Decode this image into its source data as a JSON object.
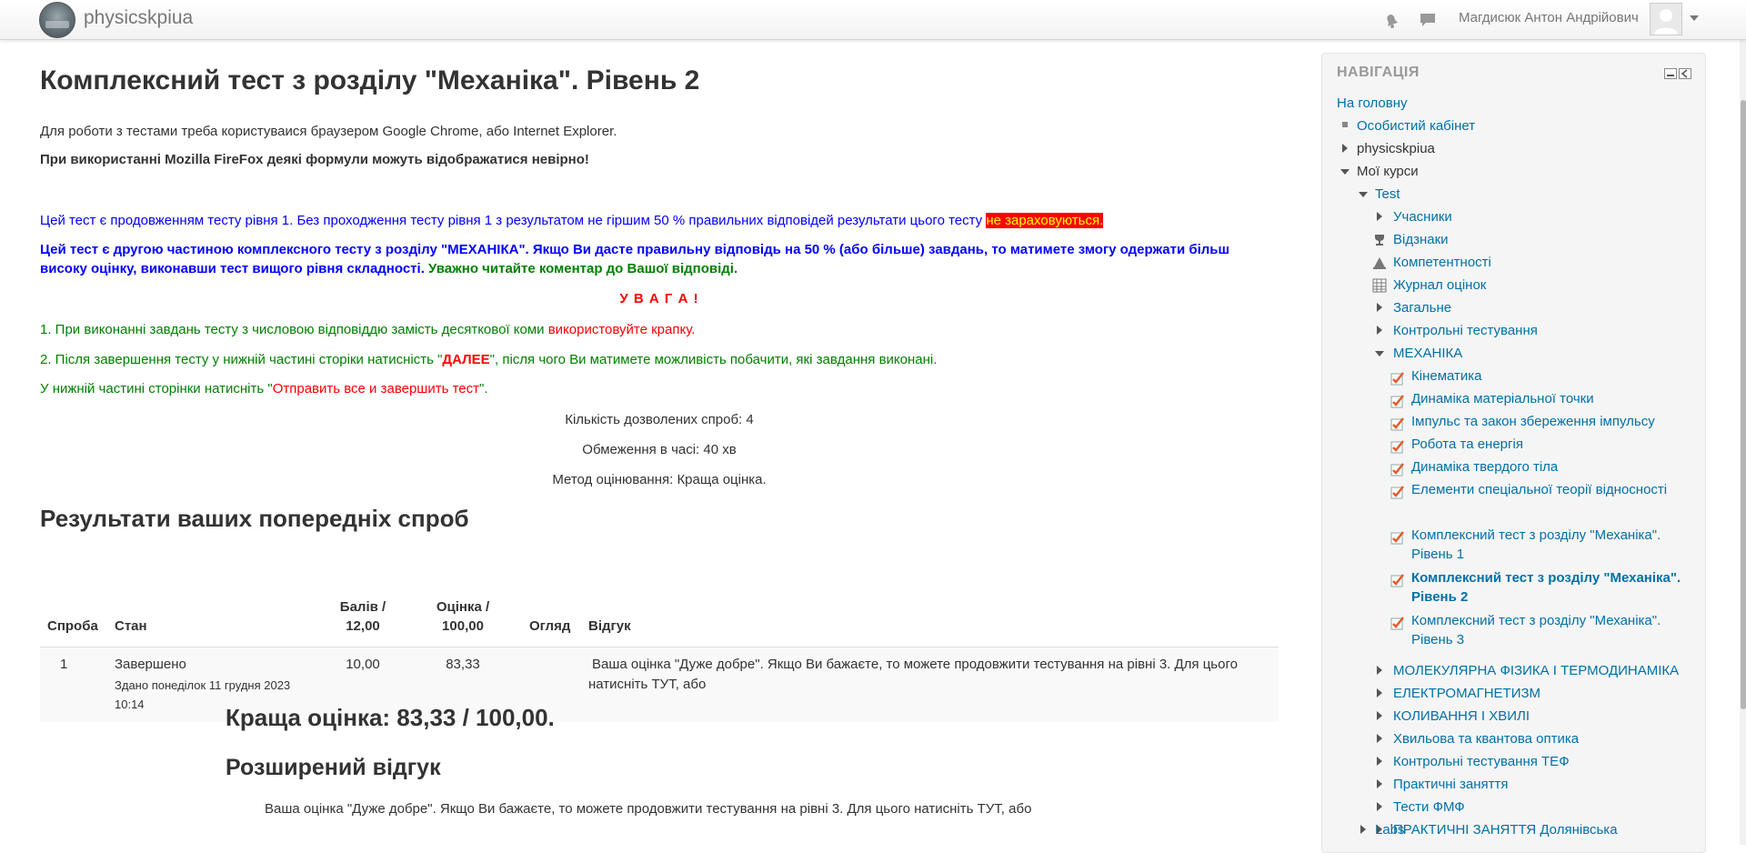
{
  "header": {
    "brand": "physicskpiua",
    "user_name": "Магдисюк Антон Андрійович"
  },
  "main": {
    "title": "Комплексний тест з розділу \"Механіка\". Рівень 2",
    "intro_line1": "Для роботи з тестами треба користуваися браузером Google Chrome, або Internet Explorer.",
    "intro_line2": "При використанні Mozilla FireFox деякі формули можуть відображатися невірно!",
    "info_blue": "Цей тест є продовженням тесту рівня 1. Без проходження тесту рівня 1 з результатом не гіршим 50 % правильних відповідей результати цього тесту ",
    "info_highlight": "не зараховуються.",
    "bold_blue_line1": "Цей тест є другою частиною комплексного тесту з розділу \"МЕХАНІКА\". Якщо Ви дасте правильну відповідь на 50 % (або більше) завдань, то матимете змогу одержати більш",
    "bold_blue_line2": "високу оцінку, виконавши тест вищого рівня складності.",
    "bold_green_tail": " Уважно читайте коментар до Вашої відповіді.",
    "attention": "У В А Г А !",
    "rule1_green": "1. При виконанні завдань тесту з числовою відповіддю замість десяткової коми ",
    "rule1_red": "використовуйте крапку.",
    "rule2_green_a": "2. Після завершення тесту у нижній частині сторіки натисність \"",
    "rule2_red": "ДАЛЕЕ",
    "rule2_green_b": "\", після чого Ви матимете можливість побачити, які завдання виконані.",
    "rule3_green_a": "У нижній частині сторінки натисніть \"",
    "rule3_red": "Отправить все и завершить тест",
    "rule3_green_b": "\".",
    "attempts_allowed": "Кількість дозволених спроб: 4",
    "time_limit": "Обмеження в часі: 40 хв",
    "grading_method": "Метод оцінювання: Краща оцінка.",
    "results_title": "Результати ваших попередніх спроб",
    "table": {
      "headers": {
        "attempt": "Спроба",
        "state": "Стан",
        "marks_a": "Балів /",
        "marks_b": "12,00",
        "grade_a": "Оцінка /",
        "grade_b": "100,00",
        "review": "Огляд",
        "feedback": "Відгук"
      },
      "rows": [
        {
          "attempt": "1",
          "state": "Завершено",
          "submitted_a": "Здано понеділок 11 грудня 2023",
          "submitted_b": "10:14",
          "marks": "10,00",
          "grade": "83,33",
          "feedback_a": "Ваша оцінка \"Дуже добре\". Якщо Ви бажаєте, то можете продовжити тестування на рівні 3. Для цього",
          "feedback_b": "натисніть ТУТ, або"
        }
      ]
    },
    "best_grade": "Краща оцінка: 83,33 / 100,00.",
    "overall_feedback_title": "Розширений відгук",
    "overall_feedback_text": "Ваша оцінка \"Дуже добре\". Якщо Ви бажаєте, то можете продовжити тестування на рівні 3. Для цього натисніть ТУТ, або"
  },
  "navigation": {
    "title": "НАВІГАЦІЯ",
    "home": "На головну",
    "dashboard": "Особистий кабінет",
    "site": "physicskpiua",
    "my_courses": "Мої курси",
    "course": "Test",
    "participants": "Учасники",
    "badges": "Відзнаки",
    "competencies": "Компетентності",
    "grades": "Журнал оцінок",
    "general": "Загальне",
    "control_tests": "Контрольні тестування",
    "mechanics": "МЕХАНІКА",
    "quizzes": [
      "Кінематика",
      "Динаміка матеріальної точки",
      "Імпульс та закон збереження імпульсу",
      "Робота та енергія",
      "Динаміка твердого тіла",
      "Елементи спеціальної теорії відносності"
    ],
    "quiz_level1_a": "Комплексний тест з розділу \"Механіка\".",
    "quiz_level1_b": "Рівень 1",
    "quiz_level2_a": "Комплексний тест з розділу \"Механіка\".",
    "quiz_level2_b": "Рівень 2",
    "quiz_level3_a": "Комплексний тест з розділу \"Механіка\".",
    "quiz_level3_b": "Рівень 3",
    "sections": [
      "МОЛЕКУЛЯРНА ФІЗИКА І ТЕРМОДИНАМІКА",
      "ЕЛЕКТРОМАГНЕТИЗМ",
      "КОЛИВАННЯ І ХВИЛІ",
      "Хвильова та квантова оптика",
      "Контрольні тестування ТЕФ",
      "Практичні заняття",
      "Тести ФМФ",
      "ПРАКТИЧНІ ЗАНЯТТЯ Долянівська"
    ],
    "labs": "Labs"
  },
  "colors": {
    "link": "#0070a8",
    "info_blue": "#0000ff",
    "info_green": "#008000",
    "info_red": "#ff0000",
    "highlight_text": "#ffff00"
  }
}
